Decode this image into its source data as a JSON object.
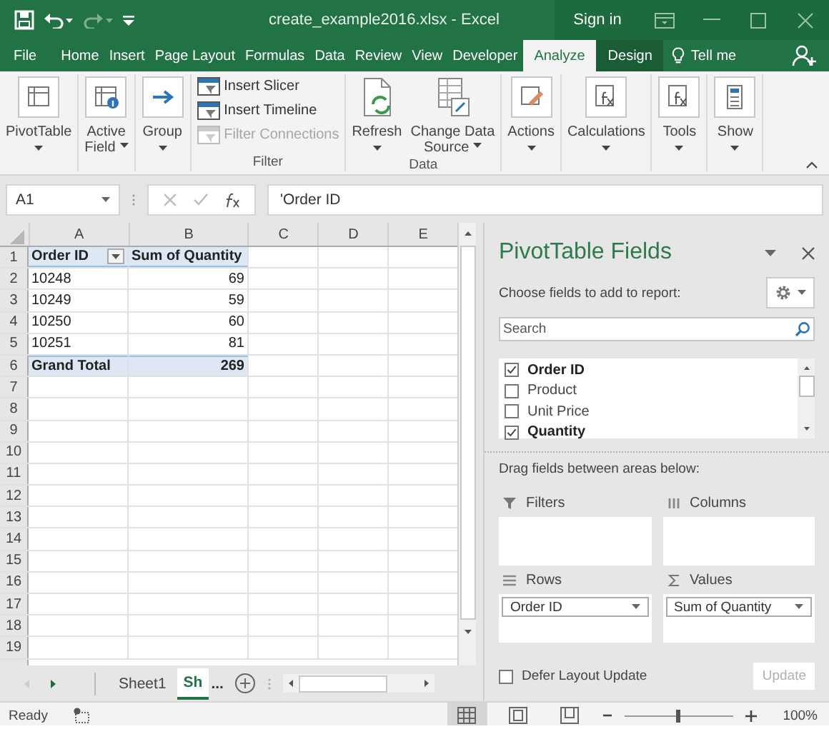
{
  "title_bar": {
    "title": "create_example2016.xlsx  -  Excel",
    "sign_in": "Sign in"
  },
  "ribbon_tabs": [
    {
      "label": "File",
      "kind": "normal",
      "selected": false
    },
    {
      "label": "Home",
      "kind": "normal",
      "selected": false
    },
    {
      "label": "Insert",
      "kind": "normal",
      "selected": false
    },
    {
      "label": "Page Layout",
      "kind": "normal",
      "selected": false
    },
    {
      "label": "Formulas",
      "kind": "normal",
      "selected": false
    },
    {
      "label": "Data",
      "kind": "normal",
      "selected": false
    },
    {
      "label": "Review",
      "kind": "normal",
      "selected": false
    },
    {
      "label": "View",
      "kind": "normal",
      "selected": false
    },
    {
      "label": "Developer",
      "kind": "normal",
      "selected": false
    },
    {
      "label": "Analyze",
      "kind": "contextual",
      "selected": true
    },
    {
      "label": "Design",
      "kind": "contextual",
      "selected": false
    }
  ],
  "tell_me": "Tell me",
  "ribbon_groups": [
    {
      "buttons": [
        {
          "kind": "large",
          "lines": [
            "PivotTable"
          ]
        }
      ]
    },
    {
      "buttons": [
        {
          "kind": "large",
          "lines": [
            "Active",
            "Field"
          ]
        }
      ]
    },
    {
      "buttons": [
        {
          "kind": "large",
          "lines": [
            "Group"
          ]
        }
      ]
    },
    {
      "label": "Filter",
      "buttons": [
        {
          "kind": "small",
          "label": "Insert Slicer",
          "disabled": false
        },
        {
          "kind": "small",
          "label": "Insert Timeline",
          "disabled": false
        },
        {
          "kind": "small",
          "label": "Filter Connections",
          "disabled": true
        }
      ]
    },
    {
      "label": "Data",
      "buttons": [
        {
          "kind": "large",
          "lines": [
            "Refresh"
          ]
        },
        {
          "kind": "large",
          "lines": [
            "Change Data",
            "Source"
          ]
        }
      ]
    },
    {
      "buttons": [
        {
          "kind": "large",
          "lines": [
            "Actions"
          ]
        }
      ]
    },
    {
      "buttons": [
        {
          "kind": "large",
          "lines": [
            "Calculations"
          ]
        }
      ]
    },
    {
      "buttons": [
        {
          "kind": "large",
          "lines": [
            "Tools"
          ]
        }
      ]
    },
    {
      "buttons": [
        {
          "kind": "large",
          "lines": [
            "Show"
          ]
        }
      ]
    }
  ],
  "sheet": {
    "name_box": "A1",
    "formula": "'Order ID",
    "columns": [
      "A",
      "B",
      "C",
      "D",
      "E"
    ],
    "rows": [
      {
        "number": "1",
        "kind": "pivot_header",
        "cells": [
          "Order ID",
          "Sum of Quantity"
        ]
      },
      {
        "number": "2",
        "kind": "data",
        "cells": [
          "10248",
          "69"
        ]
      },
      {
        "number": "3",
        "kind": "data",
        "cells": [
          "10249",
          "59"
        ]
      },
      {
        "number": "4",
        "kind": "data",
        "cells": [
          "10250",
          "60"
        ]
      },
      {
        "number": "5",
        "kind": "data",
        "cells": [
          "10251",
          "81"
        ]
      },
      {
        "number": "6",
        "kind": "total",
        "cells": [
          "Grand Total",
          "269"
        ]
      },
      {
        "number": "7",
        "kind": "empty"
      },
      {
        "number": "8",
        "kind": "empty"
      },
      {
        "number": "9",
        "kind": "empty"
      },
      {
        "number": "10",
        "kind": "empty"
      },
      {
        "number": "11",
        "kind": "empty"
      },
      {
        "number": "12",
        "kind": "empty"
      },
      {
        "number": "13",
        "kind": "empty"
      },
      {
        "number": "14",
        "kind": "empty"
      },
      {
        "number": "15",
        "kind": "empty"
      },
      {
        "number": "16",
        "kind": "empty"
      },
      {
        "number": "17",
        "kind": "empty"
      },
      {
        "number": "18",
        "kind": "empty"
      },
      {
        "number": "19",
        "kind": "empty"
      }
    ]
  },
  "sheet_tabs": {
    "tabs": [
      {
        "label": "Sheet1",
        "selected": false
      },
      {
        "label": "Sh",
        "selected": true
      }
    ],
    "overflow": "..."
  },
  "pivot_panel": {
    "title": "PivotTable Fields",
    "prompt": "Choose fields to add to report:",
    "search": {
      "placeholder": "Search"
    },
    "fields": [
      {
        "label": "Order ID",
        "checked": true
      },
      {
        "label": "Product",
        "checked": false
      },
      {
        "label": "Unit Price",
        "checked": false
      },
      {
        "label": "Quantity",
        "checked": true
      }
    ],
    "areas_hint": "Drag fields between areas below:",
    "areas": [
      {
        "kind": "filters",
        "label": "Filters"
      },
      {
        "kind": "columns",
        "label": "Columns"
      },
      {
        "kind": "rows",
        "label": "Rows",
        "items": [
          "Order ID"
        ]
      },
      {
        "kind": "values",
        "label": "Values",
        "items": [
          "Sum of Quantity"
        ]
      }
    ],
    "defer_update": {
      "label": "Defer Layout Update",
      "checked": false
    },
    "update_button": {
      "label": "Update",
      "disabled": true
    }
  },
  "status_bar": {
    "status": "Ready",
    "views": [
      {
        "kind": "normal",
        "selected": true
      },
      {
        "kind": "page_layout",
        "selected": false
      },
      {
        "kind": "page_break",
        "selected": false
      }
    ],
    "zoom": {
      "level": 0.5,
      "reading": "100%"
    }
  }
}
